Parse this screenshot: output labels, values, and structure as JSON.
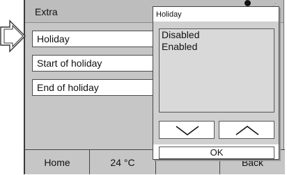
{
  "screen": {
    "title": "Extra"
  },
  "menu": {
    "items": [
      {
        "label": "Holiday"
      },
      {
        "label": "Start of holiday"
      },
      {
        "label": "End of holiday"
      }
    ]
  },
  "popup": {
    "title": "Holiday",
    "options": [
      "Disabled",
      "Enabled"
    ],
    "scroll_down_icon": "chevron-down-icon",
    "scroll_up_icon": "chevron-up-icon",
    "ok_label": "OK"
  },
  "footer": {
    "home_label": "Home",
    "temperature": "24 °C",
    "date": "",
    "back_label": "Back"
  }
}
